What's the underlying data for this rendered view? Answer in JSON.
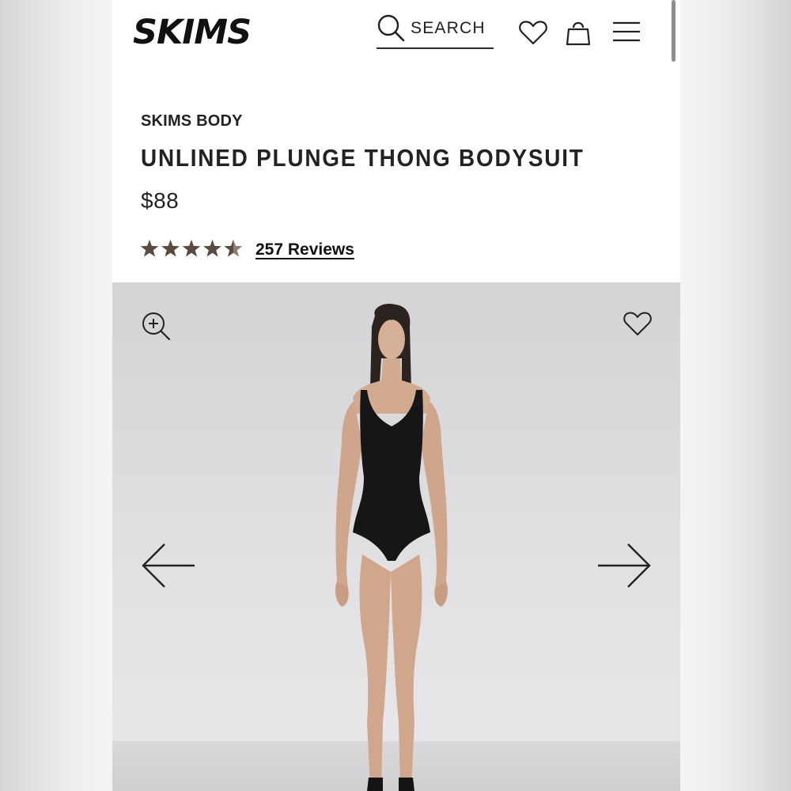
{
  "header": {
    "logo_text": "SKIMS",
    "search_label": "SEARCH",
    "icons": [
      "search-icon",
      "heart-icon",
      "shopping-bag-icon",
      "menu-icon"
    ]
  },
  "product": {
    "brand": "SKIMS BODY",
    "title": "UNLINED PLUNGE THONG BODYSUIT",
    "price": "$88",
    "rating": 4.5,
    "rating_max": 5,
    "reviews_label": "257 Reviews"
  },
  "gallery": {
    "icons": [
      "zoom-in-icon",
      "heart-icon",
      "arrow-left-icon",
      "arrow-right-icon"
    ]
  },
  "colors": {
    "star": "#5b4a40",
    "text": "#222222",
    "background": "#ffffff",
    "image_background": "#dfdfe1"
  }
}
